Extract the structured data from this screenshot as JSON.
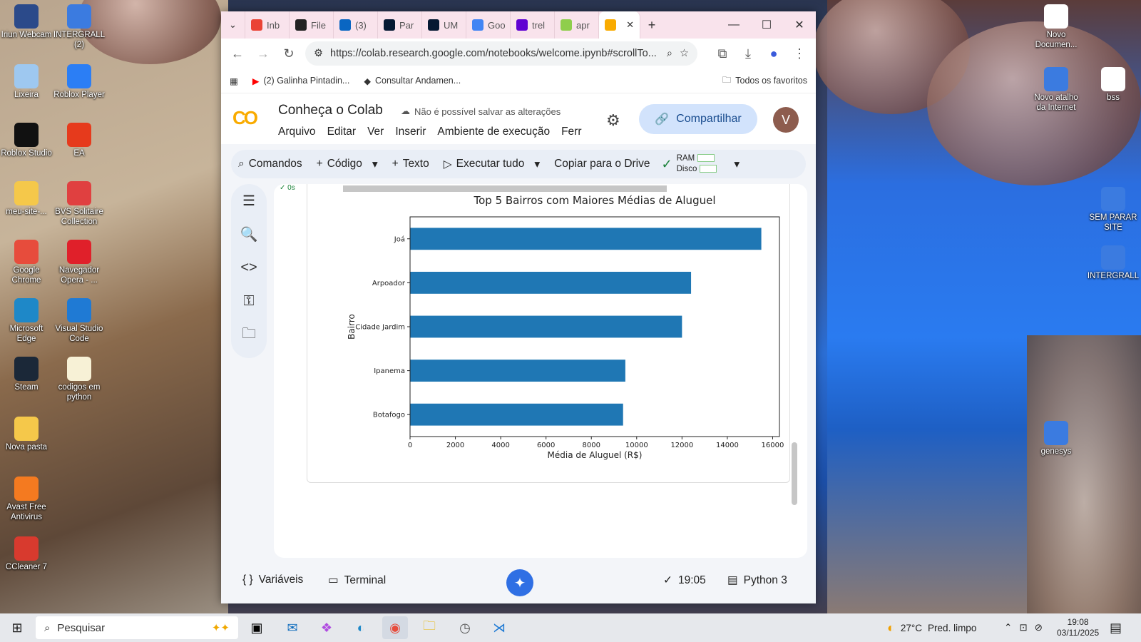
{
  "desktop": {
    "left_icons": [
      {
        "label": "Iriun Webcam",
        "icon": "iriun-icon",
        "color": "#2b4a8a"
      },
      {
        "label": "INTERGRALL (2)",
        "icon": "shortcut-icon",
        "color": "#3b7be0"
      },
      {
        "label": "Lixeira",
        "icon": "recycle-bin-icon",
        "color": "#9ec8f0"
      },
      {
        "label": "Roblox Player",
        "icon": "roblox-icon",
        "color": "#2b7ef5"
      },
      {
        "label": "Roblox Studio",
        "icon": "roblox-studio-icon",
        "color": "#111111"
      },
      {
        "label": "EA",
        "icon": "ea-icon",
        "color": "#e63a1c"
      },
      {
        "label": "meu-site-...",
        "icon": "folder-icon",
        "color": "#f5c84a"
      },
      {
        "label": "BVS Solitaire Collection",
        "icon": "cards-icon",
        "color": "#e04040"
      },
      {
        "label": "Google Chrome",
        "icon": "chrome-icon",
        "color": "#e74c3c"
      },
      {
        "label": "Navegador Opera - ...",
        "icon": "opera-icon",
        "color": "#e0202a"
      },
      {
        "label": "Microsoft Edge",
        "icon": "edge-icon",
        "color": "#1e88c8"
      },
      {
        "label": "Visual Studio Code",
        "icon": "vscode-icon",
        "color": "#1f7ad4"
      },
      {
        "label": "Steam",
        "icon": "steam-icon",
        "color": "#1b2838"
      },
      {
        "label": "codigos em python",
        "icon": "folder-icon",
        "color": "#f7f1d6"
      },
      {
        "label": "Nova pasta",
        "icon": "folder-icon",
        "color": "#f5c84a"
      },
      {
        "label": "Avast Free Antivirus",
        "icon": "avast-icon",
        "color": "#f47a20"
      },
      {
        "label": "CCleaner 7",
        "icon": "ccleaner-icon",
        "color": "#d83a2e"
      }
    ],
    "right_icons": [
      {
        "label": "Novo Documen...",
        "icon": "document-icon",
        "color": "#ffffff"
      },
      {
        "label": "Novo atalho da Internet",
        "icon": "internet-shortcut-icon",
        "color": "#3b7be0"
      },
      {
        "label": "bss",
        "icon": "file-icon",
        "color": "#ffffff"
      },
      {
        "label": "SEM PARAR SITE",
        "icon": "internet-shortcut-icon",
        "color": "#3b7be0"
      },
      {
        "label": "INTERGRALL",
        "icon": "internet-shortcut-icon",
        "color": "#3b7be0"
      },
      {
        "label": "genesys",
        "icon": "internet-shortcut-icon",
        "color": "#3b7be0"
      }
    ]
  },
  "browser": {
    "tabs": [
      {
        "label": "Inb",
        "icon": "gmail-icon",
        "color": "#ea4335"
      },
      {
        "label": "File",
        "icon": "github-icon",
        "color": "#222222"
      },
      {
        "label": "(3)",
        "icon": "linkedin-icon",
        "color": "#0a66c2"
      },
      {
        "label": "Par",
        "icon": "alura-icon",
        "color": "#051933"
      },
      {
        "label": "UM",
        "icon": "alura-icon",
        "color": "#051933"
      },
      {
        "label": "Goo",
        "icon": "gemini-icon",
        "color": "#4285f4"
      },
      {
        "label": "trel",
        "icon": "yahoo-icon",
        "color": "#6001d2"
      },
      {
        "label": "apr",
        "icon": "edit-icon",
        "color": "#8fce4c"
      },
      {
        "label": "",
        "icon": "colab-icon",
        "color": "#f9ab00",
        "active": true
      }
    ],
    "url": "https://colab.research.google.com/notebooks/welcome.ipynb#scrollTo...",
    "bookmarks": [
      {
        "label": "(2) Galinha Pintadin...",
        "icon": "youtube-icon"
      },
      {
        "label": "Consultar Andamen...",
        "icon": "site-icon"
      }
    ],
    "all_bookmarks": "Todos os favoritos"
  },
  "colab": {
    "title": "Conheça o Colab",
    "save_status": "Não é possível salvar as alterações",
    "menu": [
      "Arquivo",
      "Editar",
      "Ver",
      "Inserir",
      "Ambiente de execução",
      "Ferr"
    ],
    "share": "Compartilhar",
    "avatar": "V",
    "toolbar": {
      "commands": "Comandos",
      "code": "Código",
      "text": "Texto",
      "run_all": "Executar tudo",
      "copy_drive": "Copiar para o Drive",
      "ram": "RAM",
      "disk": "Disco"
    },
    "cell_status": "0s",
    "status": {
      "variables": "Variáveis",
      "terminal": "Terminal",
      "time": "19:05",
      "runtime": "Python 3"
    }
  },
  "chart_data": {
    "type": "bar",
    "orientation": "horizontal",
    "title": "Top 5 Bairros com Maiores Médias de Aluguel",
    "xlabel": "Média de Aluguel (R$)",
    "ylabel": "Bairro",
    "categories": [
      "Joá",
      "Arpoador",
      "Cidade Jardim",
      "Ipanema",
      "Botafogo"
    ],
    "values": [
      15500,
      12400,
      12000,
      9500,
      9400
    ],
    "xlim": [
      0,
      16300
    ],
    "xticks": [
      0,
      2000,
      4000,
      6000,
      8000,
      10000,
      12000,
      14000,
      16000
    ],
    "bar_color": "#1f77b4",
    "grid": false
  },
  "taskbar": {
    "search_placeholder": "Pesquisar",
    "weather": "27°C",
    "weather_desc": "Pred. limpo",
    "time": "19:08",
    "date": "03/11/2025"
  }
}
